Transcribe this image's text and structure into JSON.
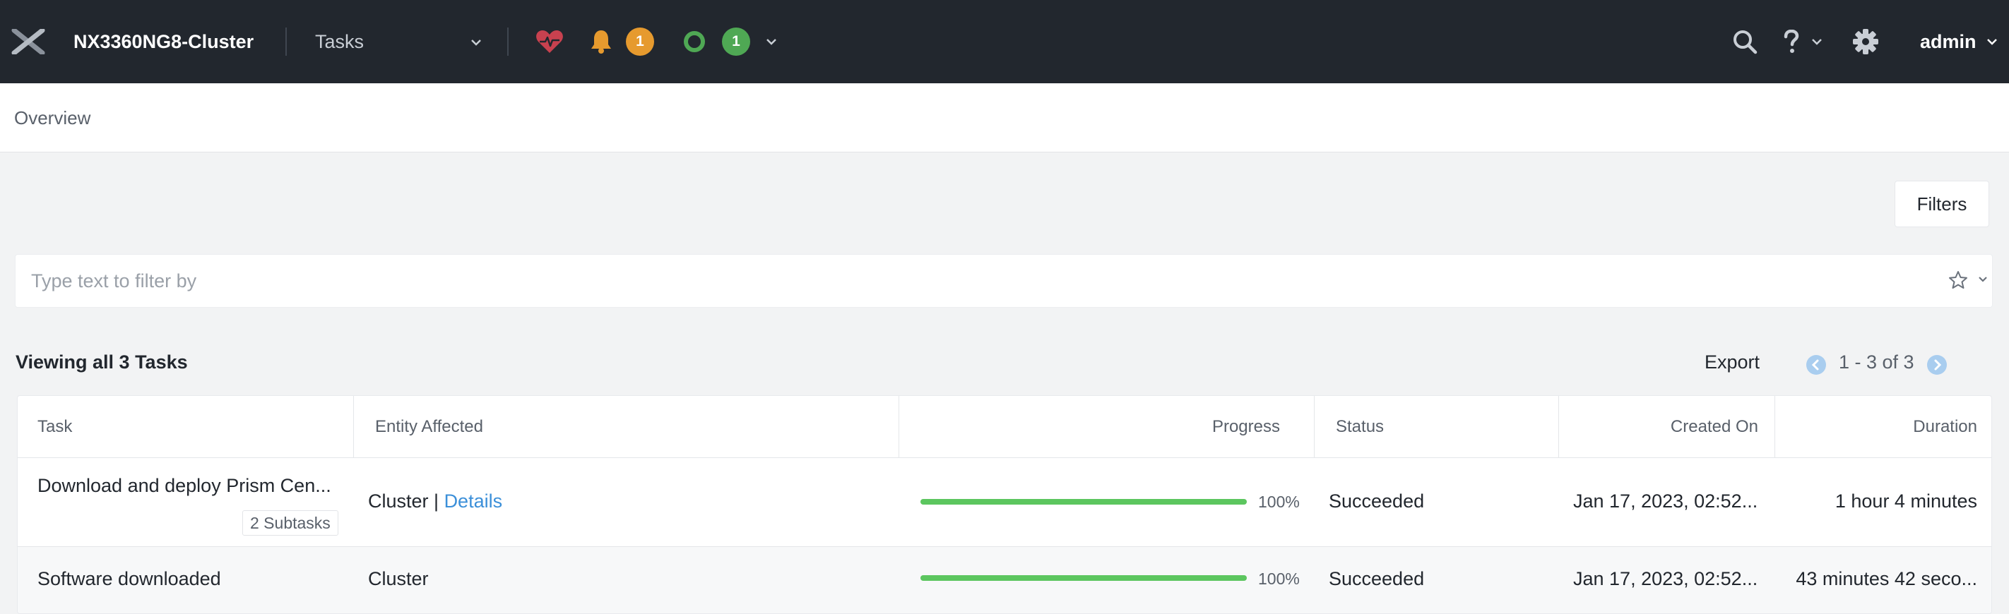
{
  "header": {
    "cluster_name": "NX3360NG8-Cluster",
    "nav_selected": "Tasks",
    "alerts_count": "1",
    "tasks_count": "1",
    "user": "admin"
  },
  "overview": {
    "label": "Overview"
  },
  "filters_label": "Filters",
  "search": {
    "placeholder": "Type text to filter by",
    "value": ""
  },
  "summary": {
    "viewing": "Viewing all 3 Tasks",
    "export": "Export",
    "pagination": "1 - 3 of 3"
  },
  "table": {
    "columns": [
      "Task",
      "Entity Affected",
      "Progress",
      "Status",
      "Created On",
      "Duration"
    ],
    "rows": [
      {
        "task": "Download and deploy Prism Cen...",
        "subtasks": "2 Subtasks",
        "entity": "Cluster",
        "entity_sep": " | ",
        "entity_link": "Details",
        "progress": 100,
        "progress_label": "100%",
        "status": "Succeeded",
        "created_on": "Jan 17, 2023, 02:52...",
        "duration": "1 hour 4 minutes"
      },
      {
        "task": "Software downloaded",
        "entity": "Cluster",
        "progress": 100,
        "progress_label": "100%",
        "status": "Succeeded",
        "created_on": "Jan 17, 2023, 02:52...",
        "duration": "43 minutes 42 seco..."
      }
    ]
  },
  "colors": {
    "topbar": "#22272e",
    "accent_link": "#3b8fd9",
    "progress": "#5cc65f",
    "alert_badge": "#e69a2e",
    "task_badge": "#4fa854",
    "health": "#c8414f"
  }
}
